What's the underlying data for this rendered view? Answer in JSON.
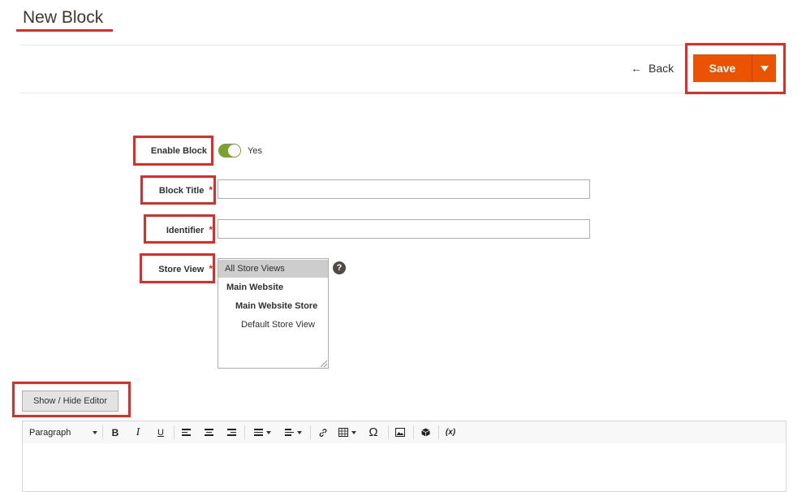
{
  "page": {
    "title": "New Block"
  },
  "actions": {
    "back_label": "Back",
    "save_label": "Save"
  },
  "form": {
    "enable_label": "Enable Block",
    "enable_value": "Yes",
    "title_label": "Block Title",
    "identifier_label": "Identifier",
    "store_view_label": "Store View",
    "required_mark": "*",
    "help_glyph": "?",
    "store_views": [
      {
        "label": "All Store Views",
        "selected": true
      },
      {
        "label": "Main Website",
        "selected": false
      },
      {
        "label": "Main Website Store",
        "selected": false
      },
      {
        "label": "Default Store View",
        "selected": false
      }
    ]
  },
  "editor": {
    "show_hide_label": "Show / Hide Editor",
    "paragraph_label": "Paragraph",
    "bold": "B",
    "italic": "I",
    "underline": "U",
    "special_char": "Ω",
    "variable": "(x)"
  },
  "colors": {
    "accent": "#eb5202",
    "highlight": "#e02b27",
    "toggle_on": "#79a22e"
  }
}
